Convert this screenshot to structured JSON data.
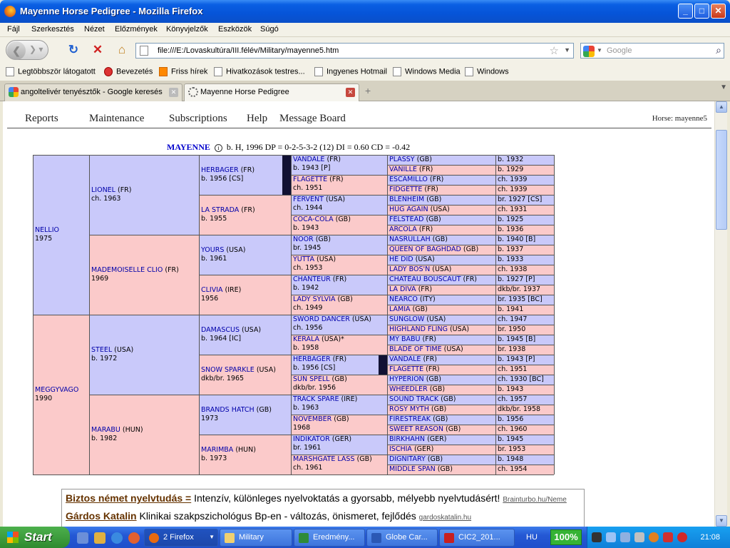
{
  "window": {
    "title": "Mayenne Horse Pedigree - Mozilla Firefox"
  },
  "menu": [
    "Fájl",
    "Szerkesztés",
    "Nézet",
    "Előzmények",
    "Könyvjelzők",
    "Eszközök",
    "Súgó"
  ],
  "url": "file:///E:/Lovaskultúra/III.félév/Military/mayenne5.htm",
  "search_placeholder": "Google",
  "bookmarks": [
    "Legtöbbször látogatott",
    "Bevezetés",
    "Friss hírek",
    "Hivatkozások testres...",
    "Ingyenes Hotmail",
    "Windows Media",
    "Windows"
  ],
  "tabs": [
    {
      "label": "angoltelivér tenyésztők - Google keresés"
    },
    {
      "label": "Mayenne Horse Pedigree"
    }
  ],
  "site_nav": [
    "Reports",
    "Maintenance",
    "Subscriptions",
    "Help",
    "Message Board"
  ],
  "horse_label": "Horse: mayenne5",
  "subject": {
    "name": "MAYENNE",
    "info": "b. H, 1996 DP = 0-2-5-3-2 (12) DI = 0.60   CD = -0.42"
  },
  "pedigree": {
    "g1": [
      {
        "name": "NELLIO",
        "cc": "",
        "info": "1975",
        "c": "b"
      },
      {
        "name": "MEGGYVAGO",
        "cc": "",
        "info": "1990",
        "c": "p"
      }
    ],
    "g2": [
      {
        "name": "LIONEL",
        "cc": " (FR)",
        "info": "ch. 1963",
        "c": "b"
      },
      {
        "name": "MADEMOISELLE CLIO",
        "cc": " (FR)",
        "info": "1969",
        "c": "p"
      },
      {
        "name": "STEEL",
        "cc": " (USA)",
        "info": "b. 1972",
        "c": "b"
      },
      {
        "name": "MARABU",
        "cc": " (HUN)",
        "info": "b. 1982",
        "c": "p"
      }
    ],
    "g3": [
      {
        "name": "HERBAGER",
        "cc": " (FR)",
        "info": "b. 1956 [CS]",
        "c": "b"
      },
      {
        "name": "LA STRADA",
        "cc": " (FR)",
        "info": "b. 1955",
        "c": "p"
      },
      {
        "name": "YOURS",
        "cc": " (USA)",
        "info": "b. 1961",
        "c": "b"
      },
      {
        "name": "CLIVIA",
        "cc": " (IRE)",
        "info": "1956",
        "c": "p"
      },
      {
        "name": "DAMASCUS",
        "cc": " (USA)",
        "info": "b. 1964 [IC]",
        "c": "b"
      },
      {
        "name": "SNOW SPARKLE",
        "cc": " (USA)",
        "info": "dkb/br. 1965",
        "c": "p"
      },
      {
        "name": "BRANDS HATCH",
        "cc": " (GB)",
        "info": "1973",
        "c": "b"
      },
      {
        "name": "MARIMBA",
        "cc": " (HUN)",
        "info": "b. 1973",
        "c": "p"
      }
    ],
    "g4": [
      {
        "name": "VANDALE",
        "cc": " (FR)",
        "info": "b. 1943 [P]",
        "c": "b"
      },
      {
        "name": "FLAGETTE",
        "cc": " (FR)",
        "info": "ch. 1951",
        "c": "p"
      },
      {
        "name": "FERVENT",
        "cc": " (USA)",
        "info": "ch. 1944",
        "c": "b"
      },
      {
        "name": "COCA-COLA",
        "cc": " (GB)",
        "info": "b. 1943",
        "c": "p"
      },
      {
        "name": "NOOR",
        "cc": " (GB)",
        "info": "br. 1945",
        "c": "b"
      },
      {
        "name": "YUTTA",
        "cc": " (USA)",
        "info": "ch. 1953",
        "c": "p"
      },
      {
        "name": "CHANTEUR",
        "cc": " (FR)",
        "info": "b. 1942",
        "c": "b"
      },
      {
        "name": "LADY SYLVIA",
        "cc": " (GB)",
        "info": "ch. 1949",
        "c": "p"
      },
      {
        "name": "SWORD DANCER",
        "cc": " (USA)",
        "info": "ch. 1956",
        "c": "b"
      },
      {
        "name": "KERALA",
        "cc": " (USA)*",
        "info": "b. 1958",
        "c": "p"
      },
      {
        "name": "HERBAGER",
        "cc": " (FR)",
        "info": "b. 1956 [CS]",
        "c": "b"
      },
      {
        "name": "SUN SPELL",
        "cc": " (GB)",
        "info": "dkb/br. 1956",
        "c": "p"
      },
      {
        "name": "TRACK SPARE",
        "cc": " (IRE)",
        "info": "b. 1963",
        "c": "b"
      },
      {
        "name": "NOVEMBER",
        "cc": " (GB)",
        "info": "1968",
        "c": "p"
      },
      {
        "name": "INDIKATOR",
        "cc": " (GER)",
        "info": "br. 1961",
        "c": "b"
      },
      {
        "name": "MARSHGATE LASS",
        "cc": " (GB)",
        "info": "ch. 1961",
        "c": "p"
      }
    ],
    "g5": [
      {
        "name": "PLASSY",
        "cc": " (GB)",
        "info": "b. 1932",
        "c": "b"
      },
      {
        "name": "VANILLE",
        "cc": " (FR)",
        "info": "b. 1929",
        "c": "p"
      },
      {
        "name": "ESCAMILLO",
        "cc": " (FR)",
        "info": "ch. 1939",
        "c": "b"
      },
      {
        "name": "FIDGETTE",
        "cc": " (FR)",
        "info": "ch. 1939",
        "c": "p"
      },
      {
        "name": "BLENHEIM",
        "cc": " (GB)",
        "info": "br. 1927 [CS]",
        "c": "b"
      },
      {
        "name": "HUG AGAIN",
        "cc": " (USA)",
        "info": "ch. 1931",
        "c": "p"
      },
      {
        "name": "FELSTEAD",
        "cc": " (GB)",
        "info": "b. 1925",
        "c": "b"
      },
      {
        "name": "ARCOLA",
        "cc": " (FR)",
        "info": "b. 1936",
        "c": "p"
      },
      {
        "name": "NASRULLAH",
        "cc": " (GB)",
        "info": "b. 1940 [B]",
        "c": "b"
      },
      {
        "name": "QUEEN OF BAGHDAD",
        "cc": " (GB)",
        "info": "b. 1937",
        "c": "p"
      },
      {
        "name": "HE DID",
        "cc": " (USA)",
        "info": "b. 1933",
        "c": "b"
      },
      {
        "name": "LADY BOS'N",
        "cc": " (USA)",
        "info": "ch. 1938",
        "c": "p"
      },
      {
        "name": "CHATEAU BOUSCAUT",
        "cc": " (FR)",
        "info": "b. 1927 [P]",
        "c": "b"
      },
      {
        "name": "LA DIVA",
        "cc": " (FR)",
        "info": "dkb/br. 1937",
        "c": "p"
      },
      {
        "name": "NEARCO",
        "cc": " (ITY)",
        "info": "br. 1935 [BC]",
        "c": "b"
      },
      {
        "name": "LAMIA",
        "cc": " (GB)",
        "info": "b. 1941",
        "c": "p"
      },
      {
        "name": "SUNGLOW",
        "cc": " (USA)",
        "info": "ch. 1947",
        "c": "b"
      },
      {
        "name": "HIGHLAND FLING",
        "cc": " (USA)",
        "info": "br. 1950",
        "c": "p"
      },
      {
        "name": "MY BABU",
        "cc": " (FR)",
        "info": "b. 1945 [B]",
        "c": "b"
      },
      {
        "name": "BLADE OF TIME",
        "cc": " (USA)",
        "info": "br. 1938",
        "c": "p"
      },
      {
        "name": "VANDALE",
        "cc": " (FR)",
        "info": "b. 1943 [P]",
        "c": "b"
      },
      {
        "name": "FLAGETTE",
        "cc": " (FR)",
        "info": "ch. 1951",
        "c": "p"
      },
      {
        "name": "HYPERION",
        "cc": " (GB)",
        "info": "ch. 1930 [BC]",
        "c": "b"
      },
      {
        "name": "WHEEDLER",
        "cc": " (GB)",
        "info": "b. 1943",
        "c": "p"
      },
      {
        "name": "SOUND TRACK",
        "cc": " (GB)",
        "info": "ch. 1957",
        "c": "b"
      },
      {
        "name": "ROSY MYTH",
        "cc": " (GB)",
        "info": "dkb/br. 1958",
        "c": "p"
      },
      {
        "name": "FIRESTREAK",
        "cc": " (GB)",
        "info": "b. 1956",
        "c": "b"
      },
      {
        "name": "SWEET REASON",
        "cc": " (GB)",
        "info": "ch. 1960",
        "c": "p"
      },
      {
        "name": "BIRKHAHN",
        "cc": " (GER)",
        "info": "b. 1945",
        "c": "b"
      },
      {
        "name": "ISCHIA",
        "cc": " (GER)",
        "info": "br. 1953",
        "c": "p"
      },
      {
        "name": "DIGNITARY",
        "cc": " (GB)",
        "info": "b. 1948",
        "c": "b"
      },
      {
        "name": "MIDDLE SPAN",
        "cc": " (GB)",
        "info": "ch. 1954",
        "c": "p"
      }
    ]
  },
  "ads": [
    {
      "title": "Biztos német nyelvtudás =",
      "text": " Intenzív, különleges nyelvoktatás a gyorsabb, mélyebb nyelvtudásért!",
      "url": "Brainturbo.hu/Neme"
    },
    {
      "title": "Gárdos Katalin",
      "text": " Klinikai szakpszichológus Bp-en - változás, önismeret, fejlődés",
      "url": "gardoskatalin.hu"
    }
  ],
  "taskbar": {
    "start": "Start",
    "buttons": [
      "2 Firefox",
      "Military",
      "Eredmény...",
      "Globe Car...",
      "CIC2_201..."
    ],
    "lang": "HU",
    "battery": "100%",
    "clock": "21:08"
  },
  "colors": {
    "sire_bg": "#c9c9fa",
    "dam_bg": "#fbcaca",
    "link": "#0000aa"
  }
}
